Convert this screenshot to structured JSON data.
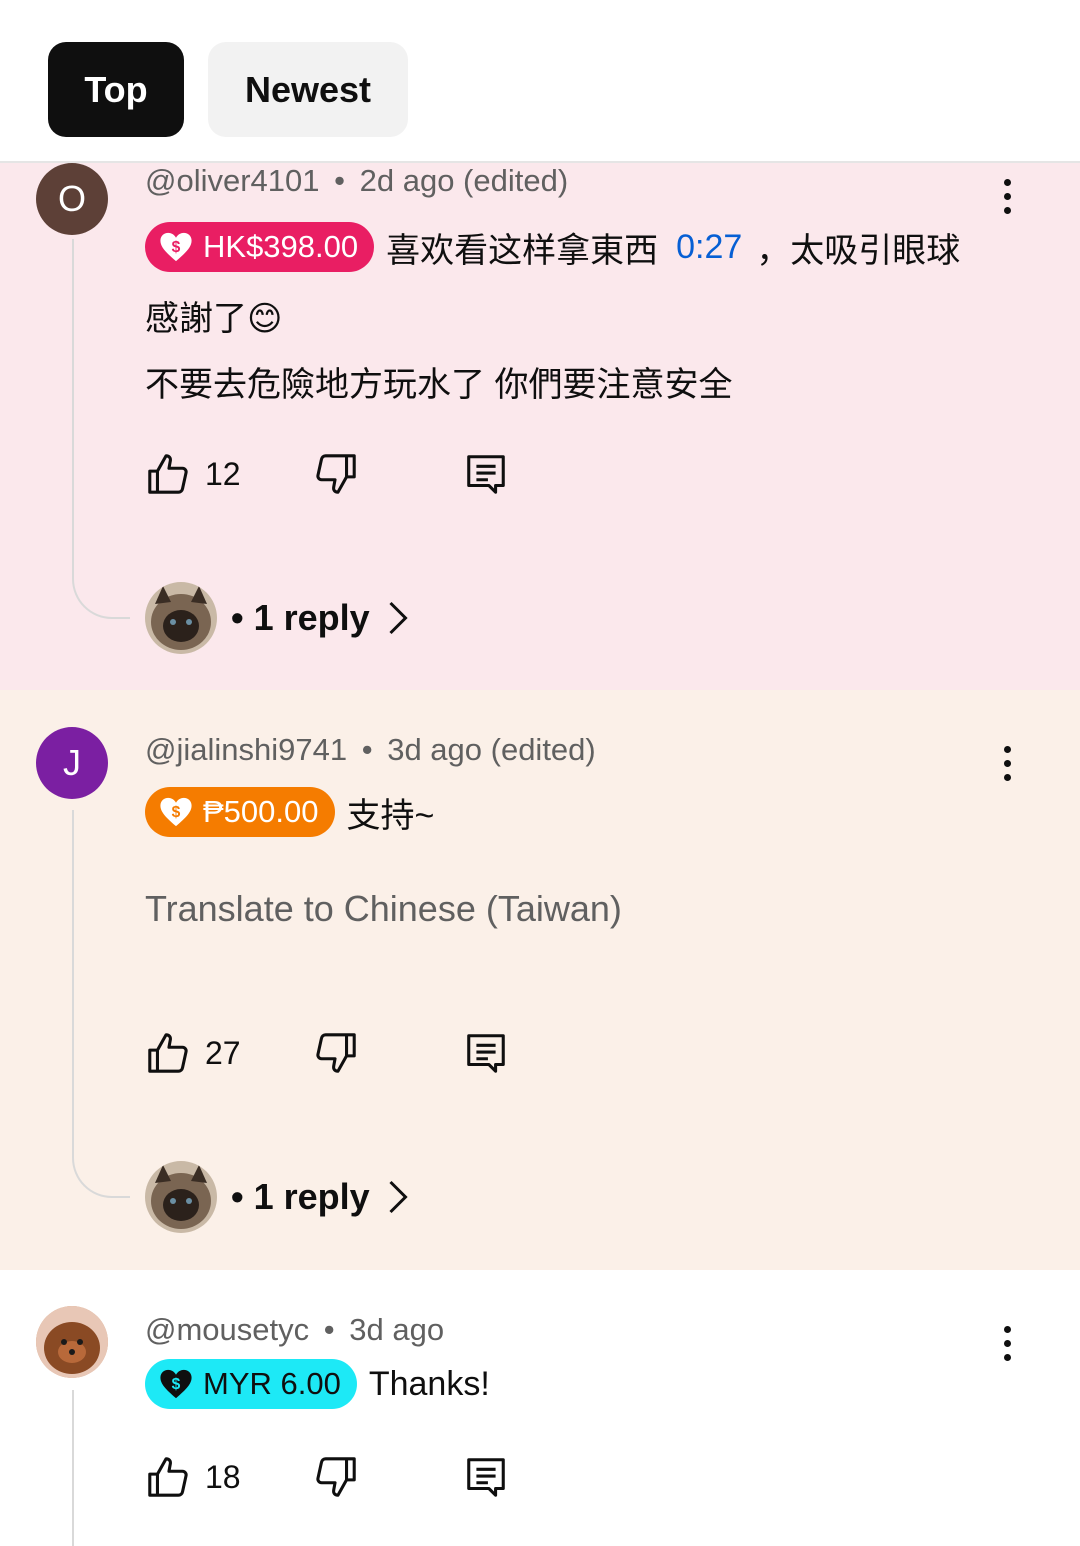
{
  "tabs": {
    "top": "Top",
    "newest": "Newest"
  },
  "comments": [
    {
      "avatar_letter": "O",
      "avatar_color": "#5d4037",
      "author": "@oliver4101",
      "time": "2d ago (edited)",
      "meta_sep": "•",
      "badge": {
        "amount": "HK$398.00",
        "color": "#e91e63",
        "text_color": "#ffffff"
      },
      "text_before_ts": "喜欢看这样拿東西",
      "timestamp_link": "0:27",
      "text_after_ts": "，太吸引眼球",
      "line2": "感謝了😊",
      "line3": "不要去危險地方玩水了 你們要注意安全",
      "likes": "12",
      "reply_label": "1 reply",
      "reply_sep": "•"
    },
    {
      "avatar_letter": "J",
      "avatar_color": "#7b1fa2",
      "author": "@jialinshi9741",
      "time": "3d ago (edited)",
      "meta_sep": "•",
      "badge": {
        "amount": "₱500.00",
        "color": "#f57c00",
        "text_color": "#ffffff"
      },
      "text": "支持~",
      "translate": "Translate to Chinese (Taiwan)",
      "likes": "27",
      "reply_label": "1 reply",
      "reply_sep": "•"
    },
    {
      "author": "@mousetyc",
      "time": "3d ago",
      "meta_sep": "•",
      "badge": {
        "amount": "MYR 6.00",
        "color": "#1de9f6",
        "text_color": "#0f0f0f"
      },
      "text": "Thanks!",
      "likes": "18"
    }
  ]
}
